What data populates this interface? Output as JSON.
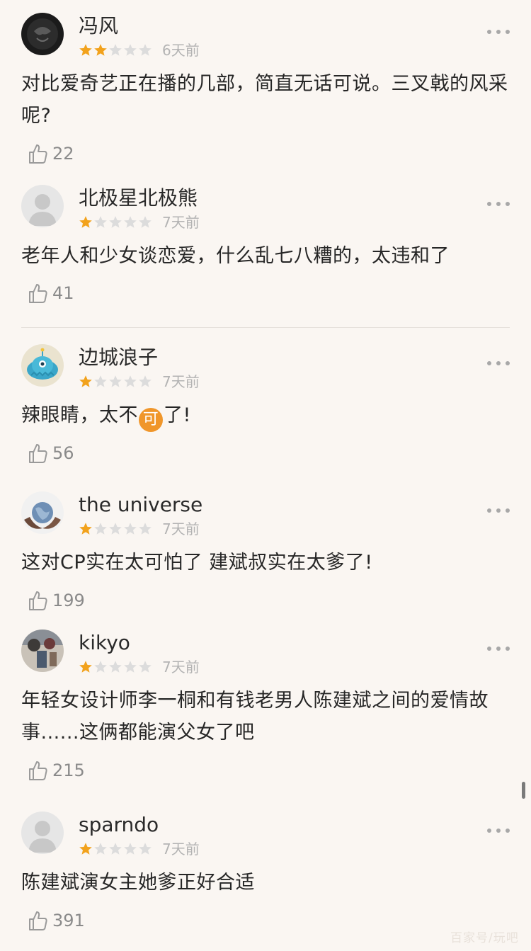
{
  "colors": {
    "background": "#faf6f2",
    "star_filled": "#f2a21c",
    "star_empty": "#dcdcdc",
    "text": "#262626",
    "meta": "#b3b3b3"
  },
  "comments": [
    {
      "username": "冯风",
      "rating": 2,
      "time": "6天前",
      "text": "对比爱奇艺正在播的几部，简直无话可说。三叉戟的风采呢?",
      "likes": "22",
      "avatar_icon": "dark-logo-avatar-icon"
    },
    {
      "username": "北极星北极熊",
      "rating": 1,
      "time": "7天前",
      "text": "老年人和少女谈恋爱，什么乱七八糟的，太违和了",
      "likes": "41",
      "avatar_icon": "default-user-avatar-icon"
    },
    {
      "username": "边城浪子",
      "rating": 1,
      "time": "7天前",
      "text_before": "辣眼睛，太不",
      "emoji": "可",
      "text_after": "了!",
      "likes": "56",
      "avatar_icon": "cartoon-alien-avatar-icon"
    },
    {
      "username": "the universe",
      "rating": 1,
      "time": "7天前",
      "text": "这对CP实在太可怕了  建斌叔实在太爹了!",
      "likes": "199",
      "avatar_icon": "globe-hands-avatar-icon"
    },
    {
      "username": "kikyo",
      "rating": 1,
      "time": "7天前",
      "text": "年轻女设计师李一桐和有钱老男人陈建斌之间的爱情故事......这俩都能演父女了吧",
      "likes": "215",
      "avatar_icon": "photo-avatar-icon"
    },
    {
      "username": "sparndo",
      "rating": 1,
      "time": "7天前",
      "text": "陈建斌演女主她爹正好合适",
      "likes": "391",
      "avatar_icon": "default-user-avatar-icon"
    }
  ],
  "watermark": "百家号/玩吧"
}
